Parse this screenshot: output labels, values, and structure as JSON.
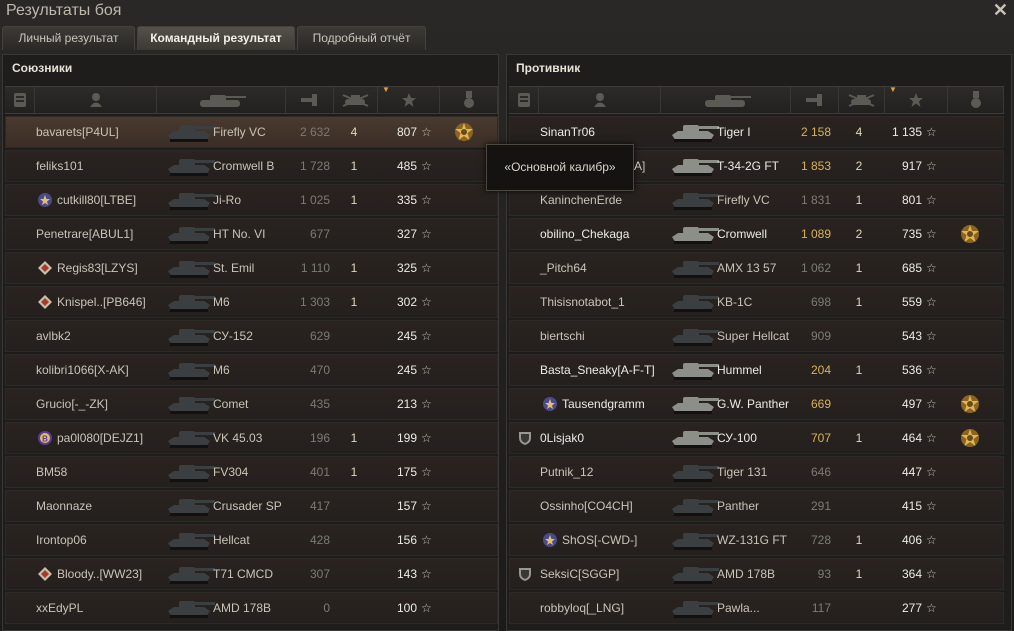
{
  "window": {
    "title": "Результаты боя",
    "close_icon": "close-icon"
  },
  "tabs": [
    {
      "label": "Личный результат",
      "active": false
    },
    {
      "label": "Командный результат",
      "active": true
    },
    {
      "label": "Подробный отчёт",
      "active": false
    }
  ],
  "allies": {
    "title": "Союзники",
    "rows": [
      {
        "player": "bavarets[P4UL]",
        "vehicle": "Firefly VC",
        "damage": "2 632",
        "kills": "4",
        "xp": "807",
        "medal": true,
        "rank": "",
        "self": true,
        "alive": false
      },
      {
        "player": "feliks101",
        "vehicle": "Cromwell B",
        "damage": "1 728",
        "kills": "1",
        "xp": "485",
        "medal": false,
        "rank": "",
        "self": false,
        "alive": false
      },
      {
        "player": "cutkill80[LTBE]",
        "vehicle": "Ji-Ro",
        "damage": "1 025",
        "kills": "1",
        "xp": "335",
        "medal": false,
        "rank": "wreath",
        "self": false,
        "alive": false
      },
      {
        "player": "Penetrare[ABUL1]",
        "vehicle": "HT No. VI",
        "damage": "677",
        "kills": "",
        "xp": "327",
        "medal": false,
        "rank": "",
        "self": false,
        "alive": false
      },
      {
        "player": "Regis83[LZYS]",
        "vehicle": "St. Emil",
        "damage": "1 110",
        "kills": "1",
        "xp": "325",
        "medal": false,
        "rank": "diamond",
        "self": false,
        "alive": false
      },
      {
        "player": "Knispel..[PB646]",
        "vehicle": "M6",
        "damage": "1 303",
        "kills": "1",
        "xp": "302",
        "medal": false,
        "rank": "diamond",
        "self": false,
        "alive": false
      },
      {
        "player": "avlbk2",
        "vehicle": "СУ-152",
        "damage": "629",
        "kills": "",
        "xp": "245",
        "medal": false,
        "rank": "",
        "self": false,
        "alive": false
      },
      {
        "player": "kolibri1066[X-AK]",
        "vehicle": "M6",
        "damage": "470",
        "kills": "",
        "xp": "245",
        "medal": false,
        "rank": "",
        "self": false,
        "alive": false
      },
      {
        "player": "Grucio[-_-ZK]",
        "vehicle": "Comet",
        "damage": "435",
        "kills": "",
        "xp": "213",
        "medal": false,
        "rank": "",
        "self": false,
        "alive": false
      },
      {
        "player": "pa0l080[DEJZ1]",
        "vehicle": "VK 45.03",
        "damage": "196",
        "kills": "1",
        "xp": "199",
        "medal": false,
        "rank": "badge-b",
        "self": false,
        "alive": false
      },
      {
        "player": "BM58",
        "vehicle": "FV304",
        "damage": "401",
        "kills": "1",
        "xp": "175",
        "medal": false,
        "rank": "",
        "self": false,
        "alive": false
      },
      {
        "player": "Maonnaze",
        "vehicle": "Crusader SP",
        "damage": "417",
        "kills": "",
        "xp": "157",
        "medal": false,
        "rank": "",
        "self": false,
        "alive": false
      },
      {
        "player": "Irontop06",
        "vehicle": "Hellcat",
        "damage": "428",
        "kills": "",
        "xp": "156",
        "medal": false,
        "rank": "",
        "self": false,
        "alive": false
      },
      {
        "player": "Bloody..[WW23]",
        "vehicle": "T71 CMCD",
        "damage": "307",
        "kills": "",
        "xp": "143",
        "medal": false,
        "rank": "diamond",
        "self": false,
        "alive": false
      },
      {
        "player": "xxEdyPL",
        "vehicle": "AMD 178B",
        "damage": "0",
        "kills": "",
        "xp": "100",
        "medal": false,
        "rank": "",
        "self": false,
        "alive": false
      }
    ]
  },
  "enemies": {
    "title": "Противник",
    "rows": [
      {
        "player": "SinanTr06",
        "vehicle": "Tiger I",
        "damage": "2 158",
        "kills": "4",
        "xp": "1 135",
        "medal": false,
        "rank": "",
        "self": false,
        "alive": true
      },
      {
        "player": "",
        "vehicle": "T-34-2G FT",
        "damage": "1 853",
        "kills": "2",
        "xp": "917",
        "medal": false,
        "rank": "",
        "self": false,
        "alive": true
      },
      {
        "player": "KaninchenErde",
        "vehicle": "Firefly VC",
        "damage": "1 831",
        "kills": "1",
        "xp": "801",
        "medal": false,
        "rank": "",
        "self": false,
        "alive": false
      },
      {
        "player": "obilino_Chekaga",
        "vehicle": "Cromwell",
        "damage": "1 089",
        "kills": "2",
        "xp": "735",
        "medal": true,
        "rank": "",
        "self": false,
        "alive": true
      },
      {
        "player": "_Pitch64",
        "vehicle": "AMX 13 57",
        "damage": "1 062",
        "kills": "1",
        "xp": "685",
        "medal": false,
        "rank": "",
        "self": false,
        "alive": false
      },
      {
        "player": "Thisisnotabot_1",
        "vehicle": "KB-1C",
        "damage": "698",
        "kills": "1",
        "xp": "559",
        "medal": false,
        "rank": "",
        "self": false,
        "alive": false
      },
      {
        "player": "biertschi",
        "vehicle": "Super Hellcat",
        "damage": "909",
        "kills": "",
        "xp": "543",
        "medal": false,
        "rank": "",
        "self": false,
        "alive": false
      },
      {
        "player": "Basta_Sneaky[A-F-T]",
        "vehicle": "Hummel",
        "damage": "204",
        "kills": "1",
        "xp": "536",
        "medal": false,
        "rank": "",
        "self": false,
        "alive": true
      },
      {
        "player": "Tausendgramm",
        "vehicle": "G.W. Panther",
        "damage": "669",
        "kills": "",
        "xp": "497",
        "medal": true,
        "rank": "wreath",
        "self": false,
        "alive": true
      },
      {
        "player": "0Lisjak0",
        "vehicle": "СУ-100",
        "damage": "707",
        "kills": "1",
        "xp": "464",
        "medal": true,
        "rank": "shield",
        "self": false,
        "alive": true
      },
      {
        "player": "Putnik_12",
        "vehicle": "Tiger 131",
        "damage": "646",
        "kills": "",
        "xp": "447",
        "medal": false,
        "rank": "",
        "self": false,
        "alive": false
      },
      {
        "player": "Ossinho[CO4CH]",
        "vehicle": "Panther",
        "damage": "291",
        "kills": "",
        "xp": "415",
        "medal": false,
        "rank": "",
        "self": false,
        "alive": false
      },
      {
        "player": "ShOS[-CWD-]",
        "vehicle": "WZ-131G FT",
        "damage": "728",
        "kills": "1",
        "xp": "406",
        "medal": false,
        "rank": "wreath",
        "self": false,
        "alive": false
      },
      {
        "player": "SeksiC[SGGP]",
        "vehicle": "AMD 178B",
        "damage": "93",
        "kills": "1",
        "xp": "364",
        "medal": false,
        "rank": "shield",
        "self": false,
        "alive": false
      },
      {
        "player": "robbyloq[_LNG]",
        "vehicle": "Pawla...",
        "damage": "117",
        "kills": "",
        "xp": "277",
        "medal": false,
        "rank": "",
        "self": false,
        "alive": false
      }
    ]
  },
  "tooltip": {
    "text": "«Основной калибр»",
    "obscured_tail": "A]"
  },
  "star_glyph": "☆",
  "colors": {
    "accent": "#d9a23c",
    "self_row": "#4a3a30",
    "damage_high": "#d9b25a"
  }
}
